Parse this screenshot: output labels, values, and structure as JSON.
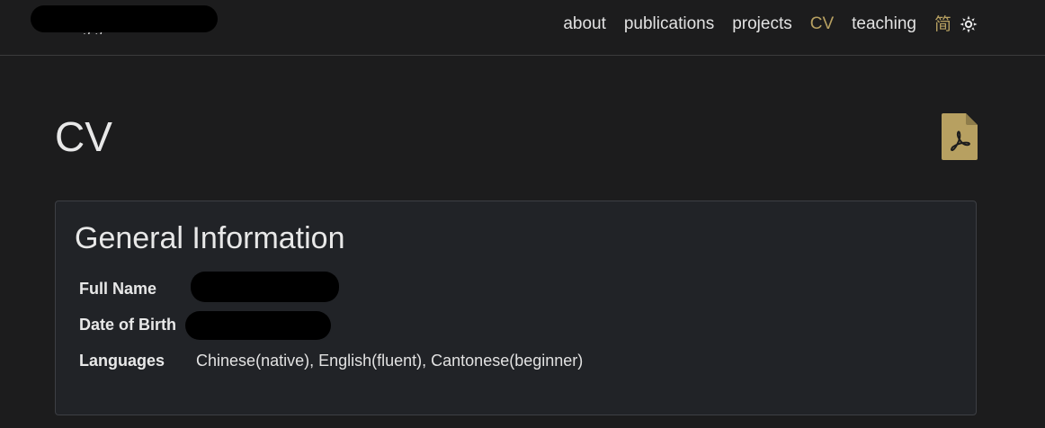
{
  "navbar": {
    "brand_visible": "g g",
    "links": [
      {
        "label": "about",
        "active": false
      },
      {
        "label": "publications",
        "active": false
      },
      {
        "label": "projects",
        "active": false
      },
      {
        "label": "CV",
        "active": true
      },
      {
        "label": "teaching",
        "active": false
      }
    ],
    "language_toggle": "简",
    "theme_icon": "sun-icon"
  },
  "page": {
    "title": "CV",
    "download_icon": "pdf-file-icon"
  },
  "general_info": {
    "title": "General Information",
    "rows": [
      {
        "label": "Full Name",
        "value": ""
      },
      {
        "label": "Date of Birth",
        "value": ""
      },
      {
        "label": "Languages",
        "value": "Chinese(native), English(fluent), Cantonese(beginner)"
      }
    ]
  },
  "colors": {
    "background": "#1c1c1d",
    "accent": "#b7a061",
    "card_background": "#212327",
    "border": "#3d3f44"
  }
}
